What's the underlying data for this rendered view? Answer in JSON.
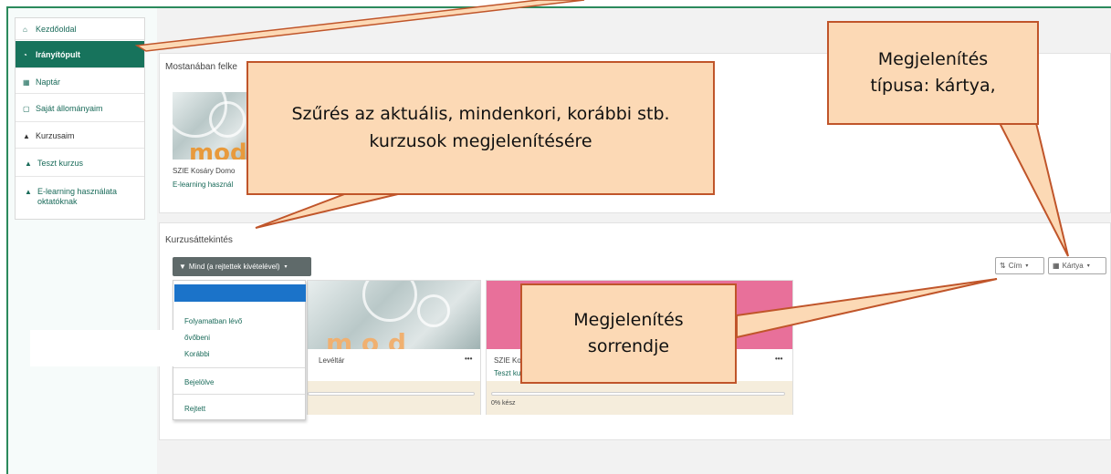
{
  "sidebar": {
    "items": [
      {
        "label": "Kezdőoldal",
        "icon": "home-icon"
      },
      {
        "label": "Irányítópult",
        "icon": "dashboard-icon"
      },
      {
        "label": "Naptár",
        "icon": "calendar-icon"
      },
      {
        "label": "Saját állományaim",
        "icon": "file-icon"
      },
      {
        "label": "Kurzusaim",
        "icon": "graduation-cap-icon"
      },
      {
        "label": "Teszt kurzus",
        "icon": "graduation-cap-icon"
      },
      {
        "label": "E-learning használata oktatóknak",
        "icon": "graduation-cap-icon"
      }
    ]
  },
  "recent": {
    "title": "Mostanában felke",
    "course_category": "SZIE Kosáry Domo",
    "course_name": "E-learning használ",
    "thumb_word": "mod"
  },
  "overview": {
    "title": "Kurzusáttekintés",
    "filter_label": "Mind (a rejtettek kivételével)",
    "filter_options": [
      "Folyamatban lévő",
      "ővőbeni",
      "Korábbi",
      "Bejelölve",
      "Rejtett"
    ],
    "sort_label": "Cím",
    "view_label": "Kártya",
    "card1": {
      "category": "Levéltár",
      "menu": "•••"
    },
    "card2": {
      "category": "SZIE Ko",
      "name": "Teszt ku",
      "menu": "•••",
      "progress": "0% kész"
    }
  },
  "callouts": {
    "filter": "Szűrés az aktuális, mindenkori, korábbi stb. kurzusok megjelenítésére",
    "view_type": "Megjelenítés típusa: kártya,",
    "sort_order": "Megjelenítés sorrendje"
  },
  "colors": {
    "accent": "#17735c",
    "callout_fill": "#fcd9b5",
    "callout_border": "#c0552a",
    "dropdown_highlight": "#1b73c9",
    "card2_header": "#e8709a"
  }
}
